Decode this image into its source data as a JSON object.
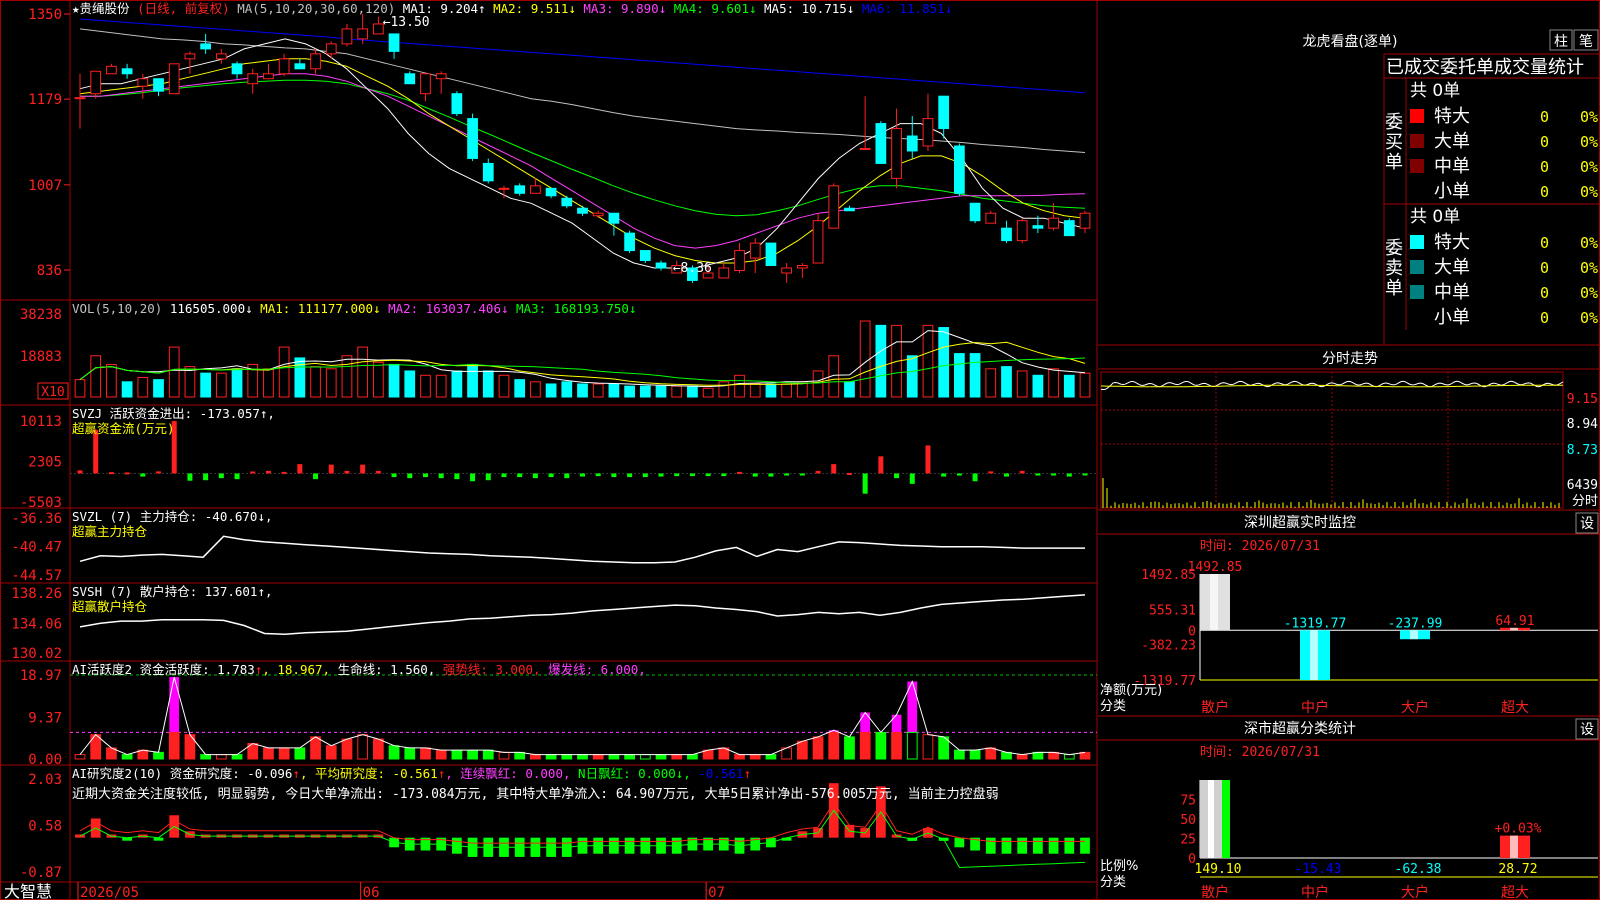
{
  "app": {
    "name": "大智慧"
  },
  "stock": {
    "title": "★贵绳股份",
    "mode": "(日线, 前复权)"
  },
  "colors": {
    "up": "#ff2020",
    "down": "#00ffff",
    "ma1": "#ffffff",
    "ma2": "#ffff00",
    "ma3": "#ff40ff",
    "ma4": "#00ff00",
    "ma5": "#c0c0c0",
    "ma6": "#0000ff",
    "grid": "#a00000",
    "green": "#00ff00"
  },
  "legends": {
    "price": [
      {
        "t": "MA(5,10,20,30,60,120)",
        "c": "#c0c0c0"
      },
      {
        "t": " MA1: 9.204↑",
        "c": "#ffffff"
      },
      {
        "t": " MA2: 9.511↓",
        "c": "#ffff00"
      },
      {
        "t": " MA3: 9.890↓",
        "c": "#ff40ff"
      },
      {
        "t": " MA4: 9.601↓",
        "c": "#00ff00"
      },
      {
        "t": " MA5: 10.715↓",
        "c": "#ffffff"
      },
      {
        "t": " MA6: 11.851↓",
        "c": "#0000ff"
      }
    ],
    "vol": [
      {
        "t": "VOL(5,10,20) ",
        "c": "#c0c0c0"
      },
      {
        "t": "116505.000↓",
        "c": "#ffffff"
      },
      {
        "t": " MA1: 111177.000↓",
        "c": "#ffff00"
      },
      {
        "t": " MA2: 163037.406↓",
        "c": "#ff40ff"
      },
      {
        "t": " MA3: 168193.750↓",
        "c": "#00ff00"
      }
    ],
    "svzj": [
      {
        "t": "SVZJ  活跃资金进出: -173.057↑,",
        "c": "#ffffff"
      }
    ],
    "svzj2": [
      {
        "t": "超赢资金流(万元)",
        "c": "#ffff00"
      }
    ],
    "svzl": [
      {
        "t": "SVZL (7) 主力持仓: -40.670↓,",
        "c": "#ffffff"
      }
    ],
    "svzl2": [
      {
        "t": "超赢主力持仓",
        "c": "#ffff00"
      }
    ],
    "svsh": [
      {
        "t": "SVSH (7) 散户持仓: 137.601↑,",
        "c": "#ffffff"
      }
    ],
    "svsh2": [
      {
        "t": "超赢散户持仓",
        "c": "#ffff00"
      }
    ],
    "ai1": [
      {
        "t": "AI活跃度2 资金活跃度: 1.783",
        "c": "#ffffff"
      },
      {
        "t": "↑",
        "c": "#ff2020"
      },
      {
        "t": ", 18.967, ",
        "c": "#ffff00"
      },
      {
        "t": "生命线: 1.560, ",
        "c": "#ffffff"
      },
      {
        "t": "强势线: 3.000, ",
        "c": "#ff2020"
      },
      {
        "t": "爆发线: 6.000,",
        "c": "#ff40ff"
      }
    ],
    "ai2": [
      {
        "t": "AI研究度2(10) 资金研究度: -0.096",
        "c": "#ffffff"
      },
      {
        "t": "↑",
        "c": "#ff2020"
      },
      {
        "t": ", 平均研究度: -0.561",
        "c": "#ffff00"
      },
      {
        "t": "↑",
        "c": "#ff2020"
      },
      {
        "t": ", 连续飘红: 0.000, ",
        "c": "#ff40ff"
      },
      {
        "t": "N日飘红: 0.000",
        "c": "#00ff00"
      },
      {
        "t": "↓, ",
        "c": "#00ff00"
      },
      {
        "t": "-0.561",
        "c": "#0000ff"
      },
      {
        "t": "↑",
        "c": "#ff2020"
      }
    ],
    "ai_comment": "近期大资金关注度较低, 明显弱势, 今日大单净流出: -173.084万元, 其中特大单净流入: 64.907万元, 大单5日累计净出-576.005万元, 当前主力控盘弱"
  },
  "axis_labels": {
    "price": [
      "1350",
      "1179",
      "1007",
      "836"
    ],
    "vol": [
      "38238",
      "18883",
      "X10"
    ],
    "svzj": [
      "10113",
      "2305",
      "-5503"
    ],
    "svzl": [
      "-36.36",
      "-40.47",
      "-44.57"
    ],
    "svsh": [
      "138.26",
      "134.06",
      "130.02"
    ],
    "ai1": [
      "18.97",
      "9.37",
      "0.00"
    ],
    "ai2": [
      "2.03",
      "0.58",
      "-0.87"
    ],
    "months": [
      "2026/05",
      "06",
      "07"
    ]
  },
  "chart_data": {
    "type": "candlestick",
    "title": "贵绳股份 日线 前复权",
    "price_axis_ticks": [
      13.5,
      11.79,
      10.07,
      8.36
    ],
    "max_label": "13.50",
    "min_label": "8.36",
    "candles": [
      [
        11.8,
        11.82,
        12.3,
        11.2
      ],
      [
        11.9,
        12.35,
        12.35,
        11.8
      ],
      [
        12.3,
        12.45,
        12.5,
        12.3
      ],
      [
        12.4,
        12.3,
        12.5,
        12.2
      ],
      [
        12.05,
        12.2,
        12.3,
        11.8
      ],
      [
        12.2,
        11.95,
        12.2,
        11.85
      ],
      [
        11.9,
        12.5,
        12.5,
        11.9
      ],
      [
        12.6,
        12.7,
        12.75,
        12.3
      ],
      [
        12.9,
        12.8,
        13.1,
        12.7
      ],
      [
        12.6,
        12.7,
        12.8,
        12.5
      ],
      [
        12.5,
        12.3,
        12.55,
        12.2
      ],
      [
        12.1,
        12.3,
        12.4,
        11.9
      ],
      [
        12.2,
        12.3,
        12.5,
        12.2
      ],
      [
        12.3,
        12.6,
        12.7,
        12.25
      ],
      [
        12.5,
        12.4,
        12.6,
        12.4
      ],
      [
        12.4,
        12.7,
        12.8,
        12.3
      ],
      [
        12.7,
        12.9,
        12.95,
        12.6
      ],
      [
        12.9,
        13.2,
        13.3,
        12.85
      ],
      [
        13.0,
        13.2,
        13.5,
        12.9
      ],
      [
        13.1,
        13.3,
        13.45,
        13.1
      ],
      [
        13.1,
        12.75,
        13.1,
        12.6
      ],
      [
        12.3,
        12.1,
        12.35,
        12.1
      ],
      [
        11.9,
        12.3,
        12.3,
        11.75
      ],
      [
        12.2,
        12.3,
        12.35,
        11.9
      ],
      [
        11.9,
        11.5,
        11.95,
        11.45
      ],
      [
        11.4,
        10.6,
        11.5,
        10.55
      ],
      [
        10.5,
        10.15,
        10.6,
        10.1
      ],
      [
        10.0,
        10.0,
        10.05,
        9.8
      ],
      [
        10.05,
        9.9,
        10.1,
        9.85
      ],
      [
        9.9,
        10.05,
        10.2,
        9.9
      ],
      [
        10.0,
        9.85,
        10.0,
        9.8
      ],
      [
        9.8,
        9.65,
        9.85,
        9.6
      ],
      [
        9.6,
        9.5,
        9.65,
        9.45
      ],
      [
        9.45,
        9.5,
        9.55,
        9.4
      ],
      [
        9.5,
        9.3,
        9.5,
        9.05
      ],
      [
        9.1,
        8.75,
        9.15,
        8.7
      ],
      [
        8.75,
        8.55,
        8.75,
        8.5
      ],
      [
        8.5,
        8.4,
        8.55,
        8.35
      ],
      [
        8.3,
        8.45,
        8.55,
        8.3
      ],
      [
        8.4,
        8.15,
        8.45,
        8.1
      ],
      [
        8.2,
        8.3,
        8.45,
        8.2
      ],
      [
        8.2,
        8.4,
        8.5,
        8.2
      ],
      [
        8.35,
        8.75,
        8.9,
        8.3
      ],
      [
        8.6,
        8.9,
        9.0,
        8.3
      ],
      [
        8.9,
        8.45,
        8.9,
        8.45
      ],
      [
        8.3,
        8.4,
        8.5,
        8.1
      ],
      [
        8.4,
        8.45,
        8.5,
        8.2
      ],
      [
        8.5,
        9.35,
        9.5,
        8.5
      ],
      [
        9.2,
        10.05,
        10.1,
        9.2
      ],
      [
        9.6,
        9.55,
        9.65,
        9.55
      ],
      [
        10.8,
        10.8,
        11.85,
        10.8
      ],
      [
        11.3,
        10.5,
        11.35,
        10.5
      ],
      [
        10.2,
        11.2,
        11.6,
        10.0
      ],
      [
        11.05,
        10.75,
        11.45,
        10.6
      ],
      [
        10.85,
        11.4,
        11.9,
        10.75
      ],
      [
        11.85,
        11.2,
        11.85,
        11.0
      ],
      [
        10.85,
        9.9,
        10.9,
        9.85
      ],
      [
        9.7,
        9.35,
        9.7,
        9.3
      ],
      [
        9.3,
        9.5,
        9.55,
        9.3
      ],
      [
        9.2,
        8.95,
        9.35,
        8.9
      ],
      [
        8.95,
        9.35,
        9.4,
        8.9
      ],
      [
        9.25,
        9.2,
        9.45,
        9.1
      ],
      [
        9.2,
        9.4,
        9.7,
        9.15
      ],
      [
        9.35,
        9.05,
        9.4,
        9.05
      ],
      [
        9.2,
        9.5,
        9.55,
        9.1
      ]
    ],
    "ma": {
      "MA1": [
        12.0,
        12.1,
        12.1,
        12.2,
        12.3,
        12.4,
        12.5,
        12.6,
        12.8,
        12.9,
        13.0,
        12.9,
        12.7,
        12.4,
        12.0,
        11.6,
        11.1,
        10.7,
        10.4,
        10.2,
        10.0,
        9.8,
        9.7,
        9.5,
        9.3,
        9.0,
        8.7,
        8.5,
        8.4,
        8.4,
        8.4,
        8.5,
        8.6,
        8.8,
        9.2,
        9.7,
        10.2,
        10.6,
        10.9,
        11.1,
        11.3,
        11.3,
        11.1,
        10.6,
        10.0,
        9.6,
        9.4,
        9.4,
        9.3,
        9.2
      ],
      "MA2": [
        11.9,
        11.95,
        12.0,
        12.05,
        12.1,
        12.2,
        12.3,
        12.4,
        12.5,
        12.55,
        12.6,
        12.6,
        12.55,
        12.45,
        12.25,
        12.05,
        11.8,
        11.5,
        11.25,
        11.0,
        10.75,
        10.5,
        10.25,
        10.0,
        9.75,
        9.5,
        9.25,
        9.0,
        8.8,
        8.65,
        8.55,
        8.5,
        8.5,
        8.55,
        8.7,
        8.95,
        9.25,
        9.6,
        9.95,
        10.25,
        10.5,
        10.65,
        10.65,
        10.5,
        10.25,
        9.95,
        9.7,
        9.55,
        9.45,
        9.4
      ],
      "MA3": [
        11.85,
        11.85,
        11.9,
        11.95,
        12.0,
        12.05,
        12.1,
        12.15,
        12.2,
        12.25,
        12.3,
        12.3,
        12.25,
        12.15,
        12.0,
        11.85,
        11.65,
        11.45,
        11.25,
        11.05,
        10.85,
        10.65,
        10.45,
        10.2,
        9.95,
        9.7,
        9.45,
        9.2,
        9.0,
        8.85,
        8.8,
        8.85,
        8.95,
        9.1,
        9.25,
        9.4,
        9.5,
        9.55,
        9.6,
        9.65,
        9.7,
        9.75,
        9.8,
        9.85,
        9.85,
        9.85,
        9.85,
        9.86,
        9.88,
        9.89
      ],
      "MA4": [
        11.85,
        11.85,
        11.88,
        11.92,
        11.97,
        12.02,
        12.06,
        12.1,
        12.13,
        12.15,
        12.17,
        12.17,
        12.15,
        12.1,
        12.0,
        11.9,
        11.77,
        11.6,
        11.43,
        11.25,
        11.08,
        10.9,
        10.72,
        10.55,
        10.38,
        10.22,
        10.05,
        9.9,
        9.77,
        9.65,
        9.55,
        9.48,
        9.45,
        9.47,
        9.55,
        9.65,
        9.78,
        9.9,
        10.0,
        10.05,
        10.05,
        10.0,
        9.95,
        9.88,
        9.8,
        9.75,
        9.7,
        9.65,
        9.62,
        9.6
      ],
      "MA5": [
        13.2,
        13.15,
        13.1,
        13.05,
        13.0,
        12.98,
        12.95,
        12.9,
        12.88,
        12.85,
        12.82,
        12.8,
        12.75,
        12.7,
        12.6,
        12.5,
        12.4,
        12.3,
        12.2,
        12.1,
        12.0,
        11.9,
        11.8,
        11.75,
        11.68,
        11.6,
        11.52,
        11.45,
        11.4,
        11.35,
        11.3,
        11.25,
        11.2,
        11.17,
        11.15,
        11.12,
        11.1,
        11.08,
        11.05,
        11.02,
        11.0,
        10.98,
        10.95,
        10.92,
        10.88,
        10.85,
        10.82,
        10.78,
        10.75,
        10.72
      ],
      "MA6": [
        13.4,
        13.37,
        13.34,
        13.31,
        13.28,
        13.25,
        13.22,
        13.19,
        13.16,
        13.13,
        13.1,
        13.07,
        13.04,
        13.0,
        12.97,
        12.94,
        12.91,
        12.88,
        12.85,
        12.82,
        12.79,
        12.76,
        12.73,
        12.7,
        12.67,
        12.64,
        12.61,
        12.58,
        12.55,
        12.52,
        12.49,
        12.46,
        12.43,
        12.4,
        12.37,
        12.34,
        12.31,
        12.28,
        12.25,
        12.22,
        12.19,
        12.16,
        12.13,
        12.1,
        12.07,
        12.04,
        12.01,
        11.98,
        11.95,
        11.92
      ]
    },
    "volume_x10": [
      800,
      1900,
      1500,
      700,
      900,
      800,
      2300,
      1400,
      1100,
      1100,
      1300,
      1500,
      1300,
      2300,
      1800,
      1400,
      1300,
      1900,
      2300,
      1600,
      1500,
      1200,
      1000,
      1000,
      1200,
      1500,
      1200,
      1000,
      800,
      700,
      600,
      700,
      600,
      600,
      600,
      500,
      500,
      500,
      500,
      500,
      400,
      700,
      1000,
      600,
      600,
      600,
      700,
      1200,
      1900,
      700,
      3500,
      3300,
      3300,
      1900,
      3300,
      3200,
      2000,
      2000,
      1300,
      1400,
      1200,
      1000,
      1300,
      1000,
      1100
    ],
    "svzj": [
      600,
      8400,
      250,
      200,
      -600,
      400,
      10100,
      -1400,
      -1300,
      -900,
      -1100,
      380,
      500,
      300,
      1800,
      -1100,
      1700,
      500,
      1700,
      500,
      -700,
      -900,
      -700,
      -900,
      -1100,
      -1500,
      -1300,
      -700,
      -700,
      -900,
      -700,
      -900,
      -600,
      -500,
      -700,
      -700,
      -700,
      -600,
      -500,
      -500,
      -500,
      -500,
      300,
      -600,
      -600,
      -400,
      -400,
      500,
      1800,
      100,
      -3900,
      3300,
      -900,
      -2000,
      5400,
      -600,
      -400,
      -1500,
      400,
      -600,
      500,
      -400,
      -400,
      -600,
      -300
    ],
    "svzl": [
      -42.6,
      -41.8,
      -41.9,
      -41.7,
      -41.6,
      -41.8,
      -42.0,
      -39.0,
      -39.5,
      -39.8,
      -40.0,
      -40.2,
      -40.4,
      -40.6,
      -40.8,
      -41.0,
      -41.2,
      -41.4,
      -41.5,
      -41.6,
      -41.8,
      -41.9,
      -42.0,
      -42.2,
      -42.4,
      -42.6,
      -42.7,
      -42.8,
      -42.8,
      -42.7,
      -42.0,
      -41.1,
      -40.6,
      -41.9,
      -40.9,
      -41.2,
      -40.5,
      -39.8,
      -39.9,
      -40.1,
      -40.3,
      -40.4,
      -40.5,
      -40.5,
      -40.5,
      -40.6,
      -40.7,
      -40.7,
      -40.7,
      -40.7
    ],
    "svsh": [
      133.6,
      134.1,
      134.4,
      134.4,
      134.6,
      134.6,
      134.6,
      134.5,
      133.8,
      132.7,
      132.6,
      132.8,
      132.9,
      133.0,
      133.3,
      133.6,
      133.9,
      134.2,
      134.4,
      134.7,
      134.8,
      135.0,
      135.2,
      135.3,
      135.5,
      135.8,
      136.0,
      136.2,
      136.4,
      136.6,
      136.5,
      136.2,
      136.0,
      135.7,
      135.1,
      135.3,
      135.6,
      135.4,
      135.6,
      135.2,
      135.6,
      136.2,
      136.7,
      136.9,
      137.1,
      137.3,
      137.4,
      137.6,
      137.8,
      138.0
    ],
    "ai_activity": [
      1,
      5.5,
      2.5,
      1,
      2,
      1.5,
      18.5,
      5.5,
      1,
      1,
      1,
      3.5,
      2.5,
      2.5,
      2.5,
      5,
      3,
      4.5,
      5.5,
      4.5,
      3,
      2.5,
      2.5,
      2,
      2,
      2,
      2,
      1.5,
      1.5,
      1,
      1,
      1,
      1,
      1,
      1,
      1,
      1,
      1,
      1,
      1,
      2,
      2.5,
      1,
      1,
      1,
      2.5,
      4,
      5,
      6.5,
      5,
      10.5,
      6,
      10,
      17.5,
      5.5,
      5,
      2,
      2,
      2.5,
      1.5,
      1,
      1.5,
      1.5,
      1,
      1.5
    ],
    "ai_research": [
      0.3,
      0.8,
      0.3,
      0.2,
      0.3,
      0.2,
      0.9,
      0.4,
      0.3,
      0.3,
      0.3,
      0.3,
      0.3,
      0.3,
      0.3,
      0.3,
      0.3,
      0.3,
      0.3,
      0.3,
      -0.1,
      -0.2,
      -0.2,
      -0.2,
      -0.3,
      -0.4,
      -0.4,
      -0.4,
      -0.4,
      -0.4,
      -0.4,
      -0.4,
      -0.3,
      -0.3,
      -0.3,
      -0.3,
      -0.3,
      -0.3,
      -0.3,
      -0.2,
      -0.2,
      -0.2,
      -0.3,
      -0.2,
      -0.1,
      0.2,
      0.4,
      0.5,
      1.9,
      0.6,
      0.5,
      1.8,
      0.3,
      0.1,
      0.5,
      0.1,
      -0.1,
      -0.2,
      -0.3,
      -0.3,
      -0.3,
      -0.3,
      -0.3,
      -0.3,
      -0.3
    ]
  },
  "right_panel": {
    "dragon": {
      "title": "龙虎看盘(逐单)",
      "btn1": "柱",
      "btn2": "笔",
      "header": "已成交委托单成交量统计"
    },
    "buy": {
      "label": "委买单",
      "total": "共 0单",
      "rows": [
        {
          "name": "特大",
          "v": "0",
          "p": "0%",
          "c": "#ff0000"
        },
        {
          "name": "大单",
          "v": "0",
          "p": "0%",
          "c": "#800000"
        },
        {
          "name": "中单",
          "v": "0",
          "p": "0%",
          "c": "#800000"
        },
        {
          "name": "小单",
          "v": "0",
          "p": "0%",
          "c": "#000000"
        }
      ]
    },
    "sell": {
      "label": "委卖单",
      "total": "共 0单",
      "rows": [
        {
          "name": "特大",
          "v": "0",
          "p": "0%",
          "c": "#00ffff"
        },
        {
          "name": "大单",
          "v": "0",
          "p": "0%",
          "c": "#008080"
        },
        {
          "name": "中单",
          "v": "0",
          "p": "0%",
          "c": "#008080"
        },
        {
          "name": "小单",
          "v": "0",
          "p": "0%",
          "c": "#000000"
        }
      ]
    },
    "intraday": {
      "title": "分时走势",
      "ticks": [
        "9.15",
        "8.94",
        "8.73",
        "6439"
      ],
      "last": "分时"
    },
    "monitor": {
      "title": "深圳超赢实时监控",
      "set": "设",
      "time": "时间: 2026/07/31",
      "ylabels": [
        "1492.85",
        "555.31",
        "0",
        "-382.23",
        "-1319.77"
      ],
      "bars": [
        {
          "name": "散户",
          "v": "1492.85"
        },
        {
          "name": "中户",
          "v": "-1319.77"
        },
        {
          "name": "大户",
          "v": "-237.99"
        },
        {
          "name": "超大",
          "v": "64.91"
        }
      ],
      "unit1": "净额(万元)",
      "unit2": "分类"
    },
    "stats": {
      "title": "深市超赢分类统计",
      "set": "设",
      "time": "时间: 2026/07/31",
      "ylabels": [
        "75",
        "50",
        "25",
        "0"
      ],
      "bars": [
        {
          "name": "散户",
          "v": "149.10"
        },
        {
          "name": "中户",
          "v": "-15.43"
        },
        {
          "name": "大户",
          "v": "-62.38"
        },
        {
          "name": "超大",
          "v": "28.72"
        }
      ],
      "pct": "+0.03%",
      "unit1": "比例%",
      "unit2": "分类"
    }
  }
}
